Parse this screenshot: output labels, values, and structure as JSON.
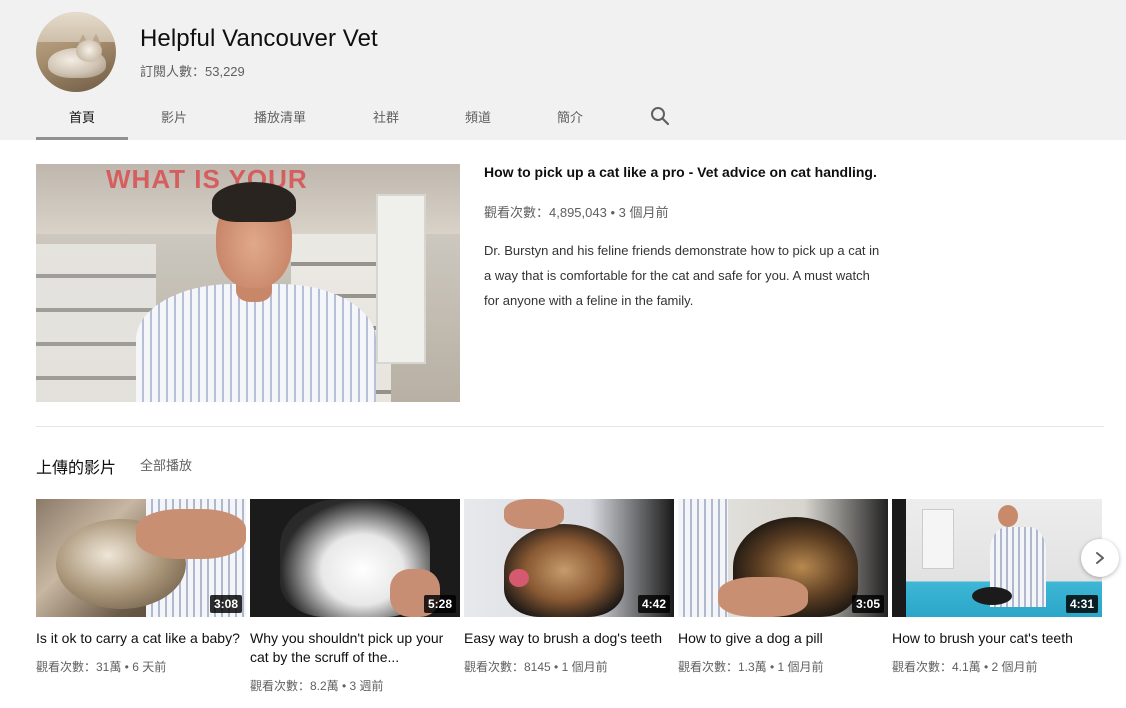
{
  "channel": {
    "name": "Helpful Vancouver Vet",
    "subscribers": "訂閱人數：53,229"
  },
  "tabs": [
    {
      "label": "首頁",
      "active": true
    },
    {
      "label": "影片",
      "active": false
    },
    {
      "label": "播放清單",
      "active": false
    },
    {
      "label": "社群",
      "active": false
    },
    {
      "label": "頻道",
      "active": false
    },
    {
      "label": "簡介",
      "active": false
    }
  ],
  "search_icon": "search-icon",
  "featured": {
    "title": "How to pick up a cat like a pro - Vet advice on cat handling.",
    "meta": "觀看次數：4,895,043 • 3 個月前",
    "description": "Dr.  Burstyn and his feline friends demonstrate how to pick up a cat in a way that is comfortable for the cat and safe for you.  A must watch for anyone with a feline in the family.",
    "thumb_sign": "WHAT IS YOUR"
  },
  "uploads": {
    "title": "上傳的影片",
    "play_all": "全部播放",
    "videos": [
      {
        "title": "Is it ok to carry a cat like a baby?",
        "duration": "3:08",
        "meta": "觀看次數：31萬 • 6 天前"
      },
      {
        "title": "Why you shouldn't pick up your cat by the scruff of the...",
        "duration": "5:28",
        "meta": "觀看次數：8.2萬 • 3 週前"
      },
      {
        "title": "Easy way to brush a dog's teeth",
        "duration": "4:42",
        "meta": "觀看次數：8145 • 1 個月前"
      },
      {
        "title": "How to give a dog a pill",
        "duration": "3:05",
        "meta": "觀看次數：1.3萬 • 1 個月前"
      },
      {
        "title": "How to brush your cat's teeth",
        "duration": "4:31",
        "meta": "觀看次數：4.1萬 • 2 個月前"
      }
    ]
  },
  "next_icon": "chevron-right-icon"
}
